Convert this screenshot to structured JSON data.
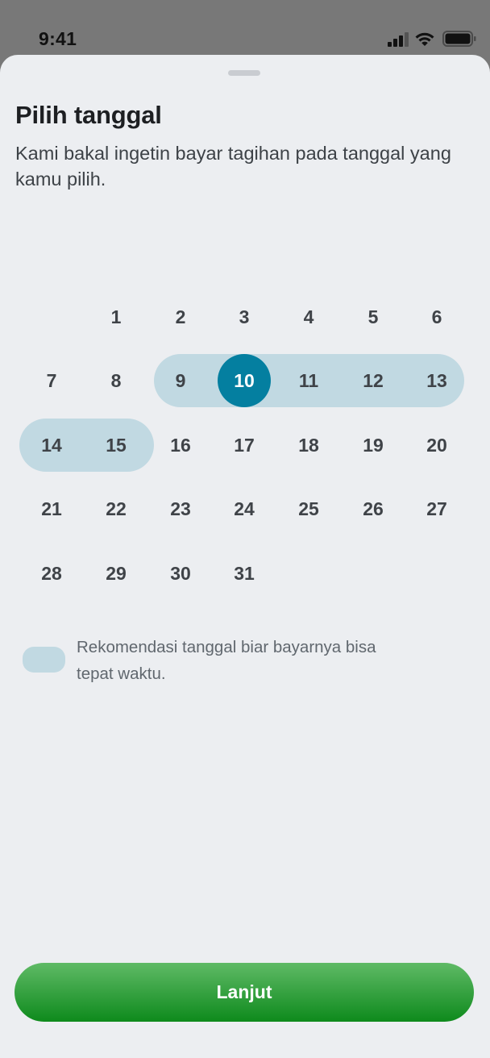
{
  "status_bar": {
    "time": "9:41",
    "icons": [
      "cellular-signal-icon",
      "wifi-icon",
      "battery-icon"
    ]
  },
  "sheet": {
    "title": "Pilih tanggal",
    "subtitle": "Kami bakal ingetin bayar tagihan pada tanggal yang kamu pilih."
  },
  "calendar": {
    "days": [
      "1",
      "2",
      "3",
      "4",
      "5",
      "6",
      "7",
      "8",
      "9",
      "10",
      "11",
      "12",
      "13",
      "14",
      "15",
      "16",
      "17",
      "18",
      "19",
      "20",
      "21",
      "22",
      "23",
      "24",
      "25",
      "26",
      "27",
      "28",
      "29",
      "30",
      "31"
    ],
    "selected_day": "10",
    "recommended_days": [
      "9",
      "10",
      "11",
      "12",
      "13",
      "14",
      "15"
    ]
  },
  "legend": {
    "text": "Rekomendasi tanggal biar bayarnya bisa tepat waktu."
  },
  "cta": {
    "label": "Lanjut"
  },
  "colors": {
    "accent": "#047fa0",
    "recommended_range": "#c1d9e2",
    "button_top": "#5fba66",
    "button_bottom": "#0e8a1c",
    "sheet_background": "#eceef1"
  }
}
